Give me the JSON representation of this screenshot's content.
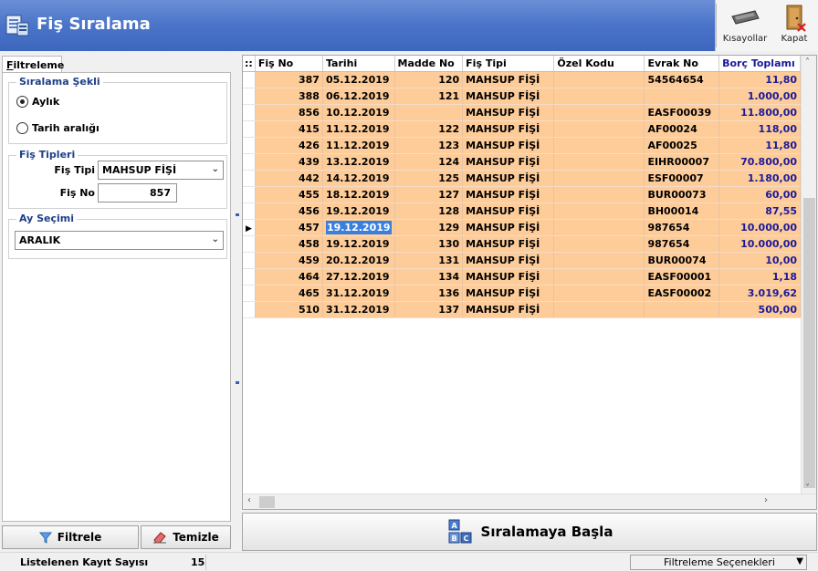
{
  "app": {
    "title": "Fiş Sıralama"
  },
  "toolbar": {
    "shortcuts_label": "Kısayollar",
    "close_label": "Kapat"
  },
  "left_panel": {
    "tab_label_first": "F",
    "tab_label_rest": "iltreleme",
    "sort_group": {
      "title": "Sıralama Şekli",
      "option_monthly": "Aylık",
      "option_range": "Tarih aralığı",
      "selected": "Aylık"
    },
    "types_group": {
      "title": "Fiş Tipleri",
      "type_label": "Fiş Tipi",
      "type_value": "MAHSUP FİŞİ",
      "no_label": "Fiş No",
      "no_value": "857"
    },
    "month_group": {
      "title": "Ay Seçimi",
      "value": "ARALIK"
    },
    "filter_button": "Filtrele",
    "clear_button": "Temizle"
  },
  "grid": {
    "corner": "::",
    "columns": [
      "Fiş No",
      "Tarihi",
      "Madde No",
      "Fiş Tipi",
      "Özel Kodu",
      "Evrak No",
      "Borç Toplamı"
    ],
    "rows": [
      [
        "387",
        "05.12.2019",
        "120",
        "MAHSUP FİŞİ",
        "",
        "54564654",
        "11,80"
      ],
      [
        "388",
        "06.12.2019",
        "121",
        "MAHSUP FİŞİ",
        "",
        "",
        "1.000,00"
      ],
      [
        "856",
        "10.12.2019",
        "",
        "MAHSUP FİŞİ",
        "",
        "EASF00039",
        "11.800,00"
      ],
      [
        "415",
        "11.12.2019",
        "122",
        "MAHSUP FİŞİ",
        "",
        "AF00024",
        "118,00"
      ],
      [
        "426",
        "11.12.2019",
        "123",
        "MAHSUP FİŞİ",
        "",
        "AF00025",
        "11,80"
      ],
      [
        "439",
        "13.12.2019",
        "124",
        "MAHSUP FİŞİ",
        "",
        "EIHR00007",
        "70.800,00"
      ],
      [
        "442",
        "14.12.2019",
        "125",
        "MAHSUP FİŞİ",
        "",
        "ESF00007",
        "1.180,00"
      ],
      [
        "455",
        "18.12.2019",
        "127",
        "MAHSUP FİŞİ",
        "",
        "BUR00073",
        "60,00"
      ],
      [
        "456",
        "19.12.2019",
        "128",
        "MAHSUP FİŞİ",
        "",
        "BH00014",
        "87,55"
      ],
      [
        "457",
        "19.12.2019",
        "129",
        "MAHSUP FİŞİ",
        "",
        "987654",
        "10.000,00"
      ],
      [
        "458",
        "19.12.2019",
        "130",
        "MAHSUP FİŞİ",
        "",
        "987654",
        "10.000,00"
      ],
      [
        "459",
        "20.12.2019",
        "131",
        "MAHSUP FİŞİ",
        "",
        "BUR00074",
        "10,00"
      ],
      [
        "464",
        "27.12.2019",
        "134",
        "MAHSUP FİŞİ",
        "",
        "EASF00001",
        "1,18"
      ],
      [
        "465",
        "31.12.2019",
        "136",
        "MAHSUP FİŞİ",
        "",
        "EASF00002",
        "3.019,62"
      ],
      [
        "510",
        "31.12.2019",
        "137",
        "MAHSUP FİŞİ",
        "",
        "",
        "500,00"
      ]
    ],
    "selected_row": 9,
    "row_color": "#fecc98",
    "selection_color": "#3a7fdc"
  },
  "start_button": "Sıralamaya Başla",
  "status": {
    "count_label": "Listelenen Kayıt Sayısı",
    "count_value": "15",
    "options_label": "Filtreleme Seçenekleri"
  }
}
